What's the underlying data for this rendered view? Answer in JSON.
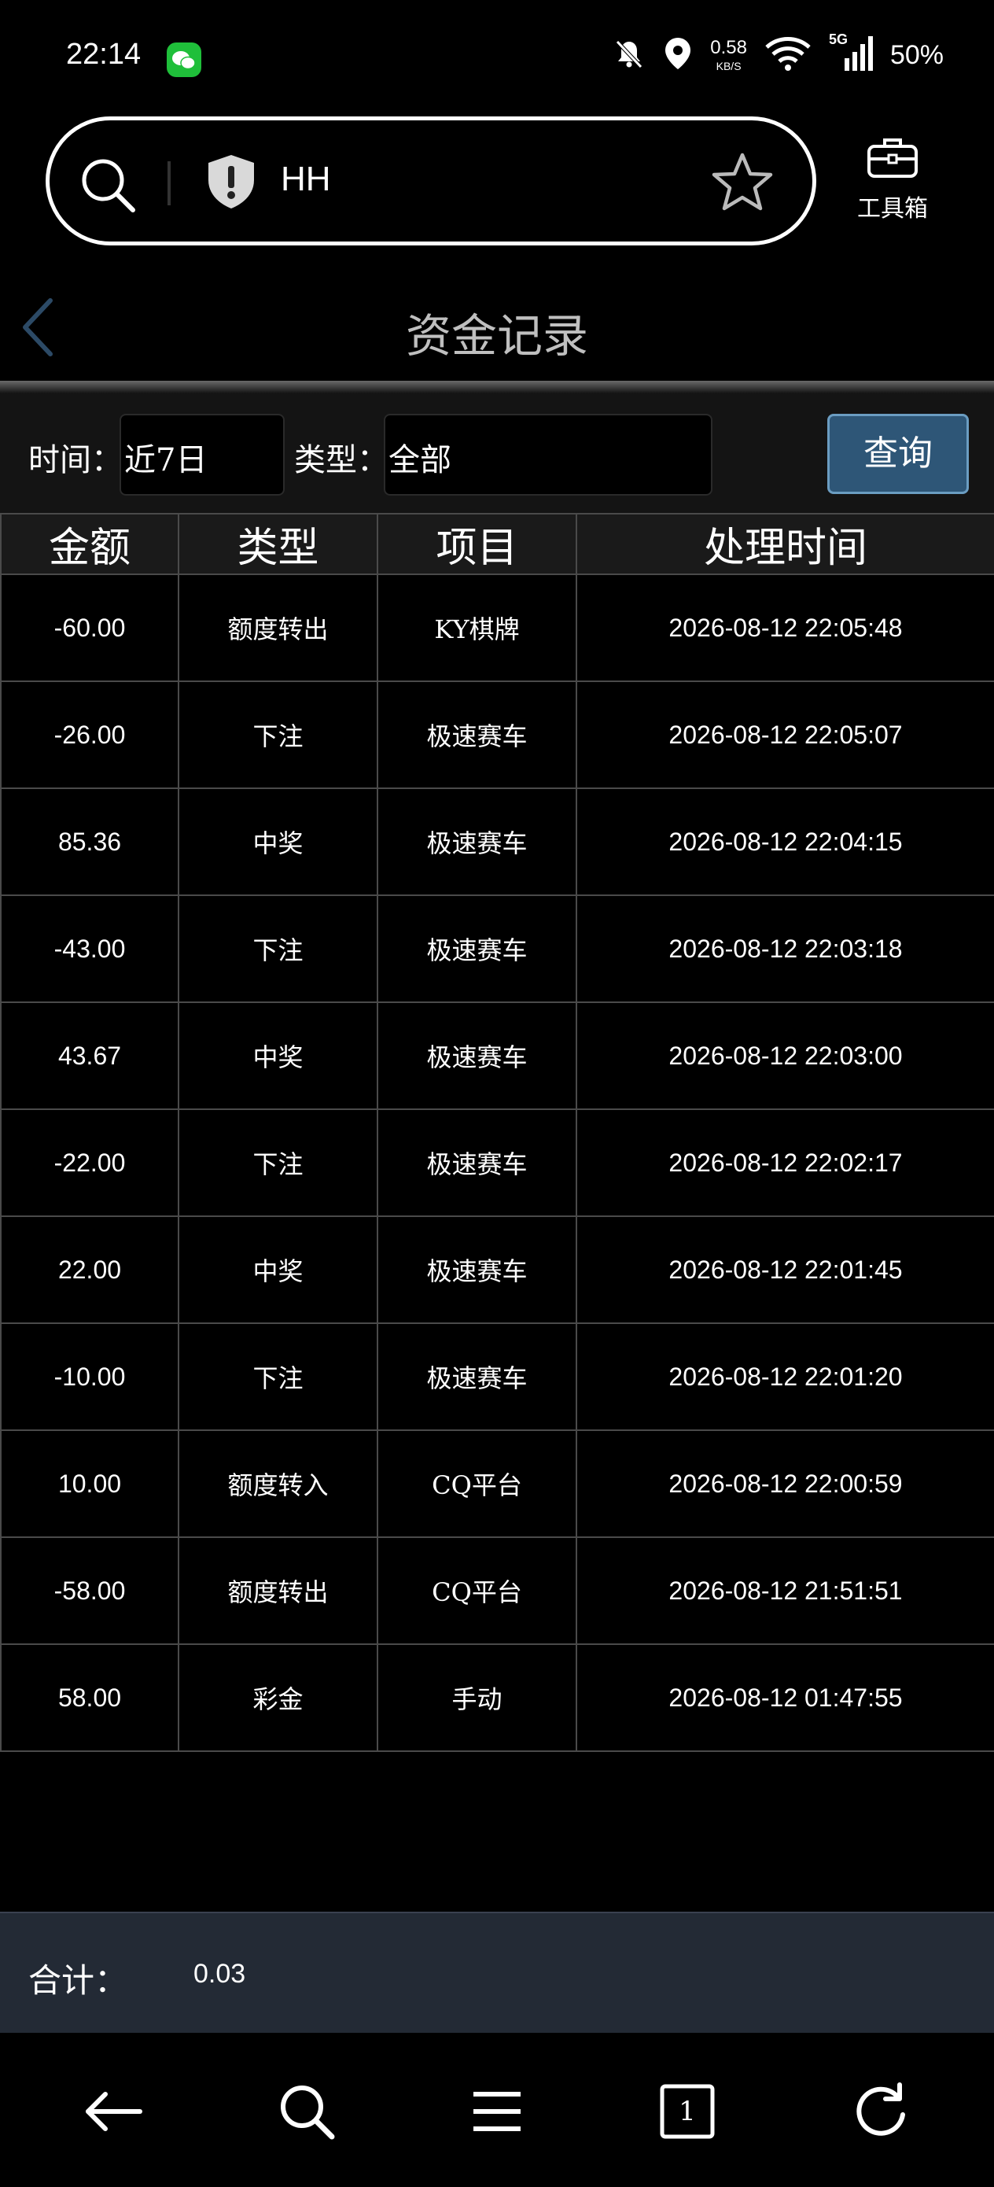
{
  "status_bar": {
    "time": "22:14",
    "net_speed": "0.58",
    "net_speed_unit": "KB/S",
    "network": "5G",
    "battery": "50%",
    "icons": [
      "wechat-icon",
      "mute-bell-icon",
      "location-icon",
      "wifi-icon",
      "signal-icon"
    ]
  },
  "address_bar": {
    "text": "HH",
    "toolbox_label": "工具箱",
    "icons": [
      "search-icon",
      "shield-icon",
      "star-icon",
      "toolbox-icon"
    ]
  },
  "header": {
    "title": "资金记录"
  },
  "filter": {
    "time_label": "时间：",
    "time_value": "近7日",
    "type_label": "类型：",
    "type_value": "全部",
    "query_button": "查询"
  },
  "table": {
    "columns": [
      "金额",
      "类型",
      "项目",
      "处理时间"
    ],
    "rows": [
      {
        "amount": "-60.00",
        "type": "额度转出",
        "project": "KY棋牌",
        "time": "2026-08-12 22:05:48"
      },
      {
        "amount": "-26.00",
        "type": "下注",
        "project": "极速赛车",
        "time": "2026-08-12 22:05:07"
      },
      {
        "amount": "85.36",
        "type": "中奖",
        "project": "极速赛车",
        "time": "2026-08-12 22:04:15"
      },
      {
        "amount": "-43.00",
        "type": "下注",
        "project": "极速赛车",
        "time": "2026-08-12 22:03:18"
      },
      {
        "amount": "43.67",
        "type": "中奖",
        "project": "极速赛车",
        "time": "2026-08-12 22:03:00"
      },
      {
        "amount": "-22.00",
        "type": "下注",
        "project": "极速赛车",
        "time": "2026-08-12 22:02:17"
      },
      {
        "amount": "22.00",
        "type": "中奖",
        "project": "极速赛车",
        "time": "2026-08-12 22:01:45"
      },
      {
        "amount": "-10.00",
        "type": "下注",
        "project": "极速赛车",
        "time": "2026-08-12 22:01:20"
      },
      {
        "amount": "10.00",
        "type": "额度转入",
        "project": "CQ平台",
        "time": "2026-08-12 22:00:59"
      },
      {
        "amount": "-58.00",
        "type": "额度转出",
        "project": "CQ平台",
        "time": "2026-08-12 21:51:51"
      },
      {
        "amount": "58.00",
        "type": "彩金",
        "project": "手动",
        "time": "2026-08-12 01:47:55"
      }
    ]
  },
  "total": {
    "label": "合计：",
    "value": "0.03"
  },
  "bottom_nav": {
    "tab_count": "1",
    "icons": [
      "back-arrow-icon",
      "search-icon",
      "menu-icon",
      "tabs-icon",
      "refresh-icon"
    ]
  }
}
